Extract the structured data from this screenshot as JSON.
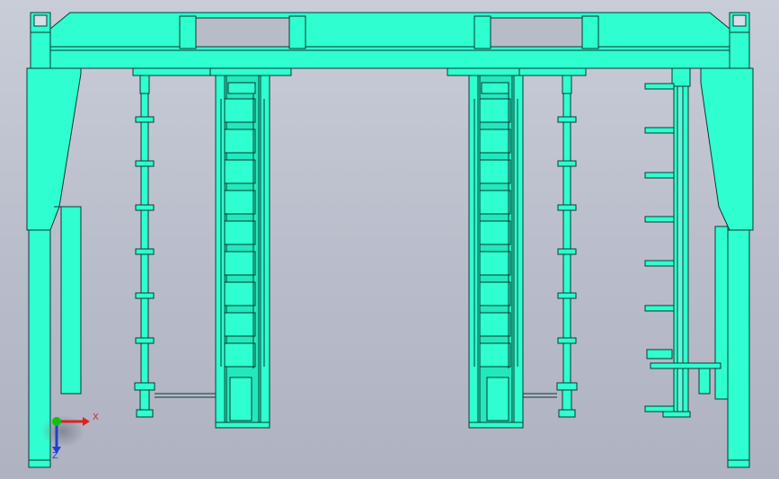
{
  "viewport": {
    "description_colors": {
      "part_fill": "#2fffd0",
      "part_stroke": "#0a3a30",
      "background_top": "#c9cdd8",
      "background_bottom": "#aeb2c1"
    }
  },
  "triad": {
    "x_label": "X",
    "y_label": "Y",
    "z_label": "Z",
    "x_color": "#e02020",
    "y_color": "#10c010",
    "z_color": "#2040d0"
  }
}
